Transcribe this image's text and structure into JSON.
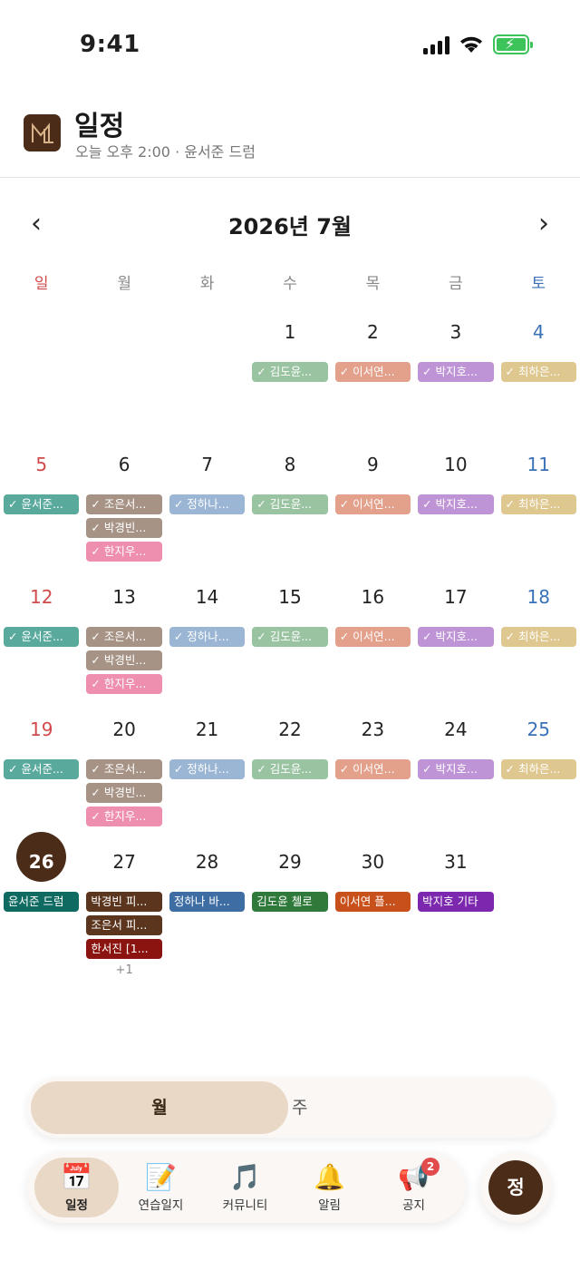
{
  "status": {
    "time": "9:41"
  },
  "header": {
    "title": "일정",
    "subtitle": "오늘 오후 2:00 · 윤서준 드럼",
    "logo": "ML"
  },
  "nav": {
    "prev": "‹",
    "next": "›",
    "month_title": "2026년 7월"
  },
  "weekdays": [
    "일",
    "월",
    "화",
    "수",
    "목",
    "금",
    "토"
  ],
  "colors": {
    "teal": "#5aa99d",
    "taupe": "#a69386",
    "blue": "#9ab6d4",
    "green": "#9ac3a1",
    "salmon": "#e3a08b",
    "purple": "#bf94d6",
    "gold": "#dfc790",
    "pink": "#ee8fb0",
    "dark_teal": "#0f6b62",
    "dark_brown": "#5b351e",
    "dark_red": "#8b1410",
    "dark_blue": "#3e6da4",
    "dark_green": "#2f7a3a",
    "dark_orange": "#c8501a",
    "dark_purple": "#7b28ae",
    "today": "#4a2c18"
  },
  "weeks": [
    [
      {
        "num": "",
        "events": []
      },
      {
        "num": "",
        "events": []
      },
      {
        "num": "",
        "events": []
      },
      {
        "num": "1",
        "events": [
          {
            "label": "✓ 김도윤...",
            "color": "green"
          }
        ]
      },
      {
        "num": "2",
        "events": [
          {
            "label": "✓ 이서연...",
            "color": "salmon"
          }
        ]
      },
      {
        "num": "3",
        "events": [
          {
            "label": "✓ 박지호...",
            "color": "purple"
          }
        ]
      },
      {
        "num": "4",
        "events": [
          {
            "label": "✓ 최하은...",
            "color": "gold"
          }
        ]
      }
    ],
    [
      {
        "num": "5",
        "events": [
          {
            "label": "✓ 윤서준...",
            "color": "teal"
          }
        ]
      },
      {
        "num": "6",
        "events": [
          {
            "label": "✓ 조은서...",
            "color": "taupe"
          },
          {
            "label": "✓ 박경빈...",
            "color": "taupe"
          },
          {
            "label": "✓ 한지우...",
            "color": "pink"
          }
        ]
      },
      {
        "num": "7",
        "events": [
          {
            "label": "✓ 정하나...",
            "color": "blue"
          }
        ]
      },
      {
        "num": "8",
        "events": [
          {
            "label": "✓ 김도윤...",
            "color": "green"
          }
        ]
      },
      {
        "num": "9",
        "events": [
          {
            "label": "✓ 이서연...",
            "color": "salmon"
          }
        ]
      },
      {
        "num": "10",
        "events": [
          {
            "label": "✓ 박지호...",
            "color": "purple"
          }
        ]
      },
      {
        "num": "11",
        "events": [
          {
            "label": "✓ 최하은...",
            "color": "gold"
          }
        ]
      }
    ],
    [
      {
        "num": "12",
        "events": [
          {
            "label": "✓ 윤서준...",
            "color": "teal"
          }
        ]
      },
      {
        "num": "13",
        "events": [
          {
            "label": "✓ 조은서...",
            "color": "taupe"
          },
          {
            "label": "✓ 박경빈...",
            "color": "taupe"
          },
          {
            "label": "✓ 한지우...",
            "color": "pink"
          }
        ]
      },
      {
        "num": "14",
        "events": [
          {
            "label": "✓ 정하나...",
            "color": "blue"
          }
        ]
      },
      {
        "num": "15",
        "events": [
          {
            "label": "✓ 김도윤...",
            "color": "green"
          }
        ]
      },
      {
        "num": "16",
        "events": [
          {
            "label": "✓ 이서연...",
            "color": "salmon"
          }
        ]
      },
      {
        "num": "17",
        "events": [
          {
            "label": "✓ 박지호...",
            "color": "purple"
          }
        ]
      },
      {
        "num": "18",
        "events": [
          {
            "label": "✓ 최하은...",
            "color": "gold"
          }
        ]
      }
    ],
    [
      {
        "num": "19",
        "events": [
          {
            "label": "✓ 윤서준...",
            "color": "teal"
          }
        ]
      },
      {
        "num": "20",
        "events": [
          {
            "label": "✓ 조은서...",
            "color": "taupe"
          },
          {
            "label": "✓ 박경빈...",
            "color": "taupe"
          },
          {
            "label": "✓ 한지우...",
            "color": "pink"
          }
        ]
      },
      {
        "num": "21",
        "events": [
          {
            "label": "✓ 정하나...",
            "color": "blue"
          }
        ]
      },
      {
        "num": "22",
        "events": [
          {
            "label": "✓ 김도윤...",
            "color": "green"
          }
        ]
      },
      {
        "num": "23",
        "events": [
          {
            "label": "✓ 이서연...",
            "color": "salmon"
          }
        ]
      },
      {
        "num": "24",
        "events": [
          {
            "label": "✓ 박지호...",
            "color": "purple"
          }
        ]
      },
      {
        "num": "25",
        "events": [
          {
            "label": "✓ 최하은...",
            "color": "gold"
          }
        ]
      }
    ],
    [
      {
        "num": "26",
        "today": true,
        "events": [
          {
            "label": "윤서준 드럼",
            "color": "dark_teal"
          }
        ]
      },
      {
        "num": "27",
        "events": [
          {
            "label": "박경빈 피...",
            "color": "dark_brown"
          },
          {
            "label": "조은서 피...",
            "color": "dark_brown"
          },
          {
            "label": "한서진 [1...",
            "color": "dark_red"
          }
        ],
        "more": "+1"
      },
      {
        "num": "28",
        "events": [
          {
            "label": "정하나 바...",
            "color": "dark_blue"
          }
        ]
      },
      {
        "num": "29",
        "events": [
          {
            "label": "김도윤 첼로",
            "color": "dark_green"
          }
        ]
      },
      {
        "num": "30",
        "events": [
          {
            "label": "이서연 플...",
            "color": "dark_orange"
          }
        ]
      },
      {
        "num": "31",
        "events": [
          {
            "label": "박지호 기타",
            "color": "dark_purple"
          }
        ]
      },
      {
        "num": "",
        "events": []
      }
    ]
  ],
  "view_toggle": {
    "month": "월",
    "week": "주"
  },
  "tabs": [
    {
      "label": "일정",
      "icon": "calendar-icon",
      "glyph": "📅",
      "active": true
    },
    {
      "label": "연습일지",
      "icon": "memo-icon",
      "glyph": "📝"
    },
    {
      "label": "커뮤니티",
      "icon": "music-notes-icon",
      "glyph": "🎵"
    },
    {
      "label": "알림",
      "icon": "bell-icon",
      "glyph": "🔔"
    },
    {
      "label": "공지",
      "icon": "megaphone-icon",
      "glyph": "📢",
      "badge": "2"
    }
  ],
  "profile": {
    "initial": "정"
  }
}
